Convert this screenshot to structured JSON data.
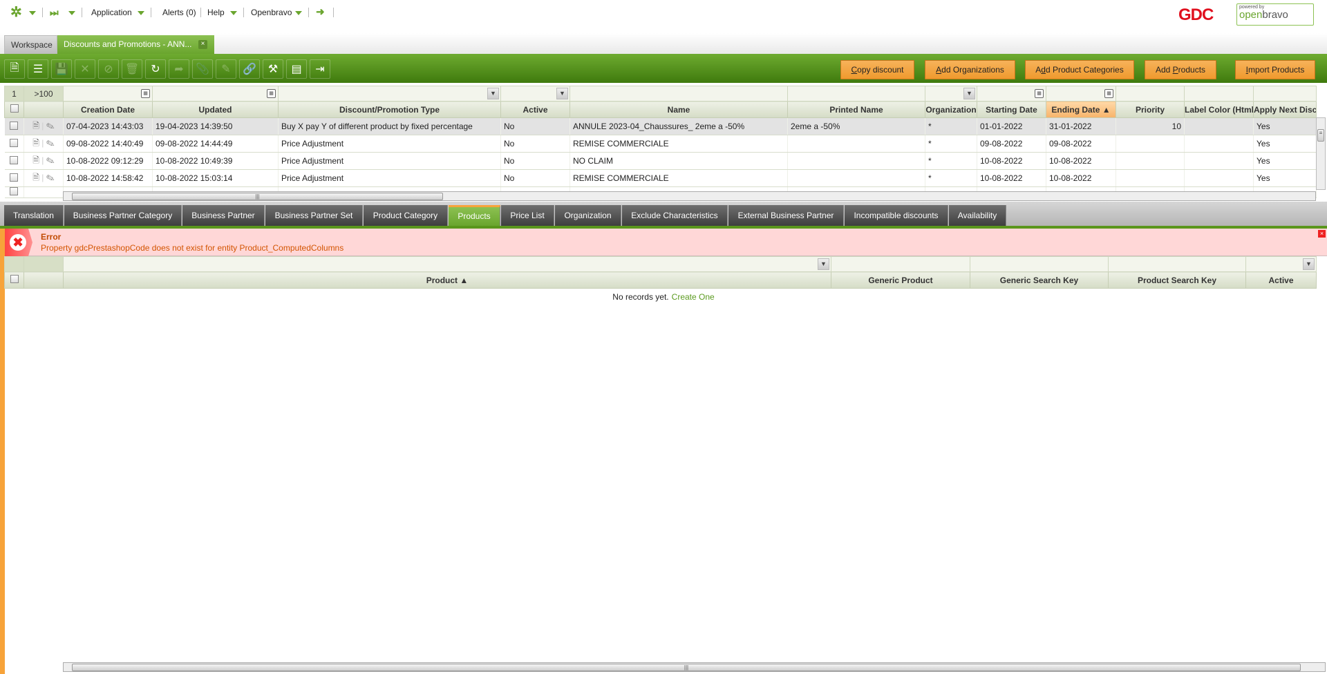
{
  "top_menu": {
    "application": "Application",
    "alerts": "Alerts (0)",
    "help": "Help",
    "openbravo": "Openbravo"
  },
  "logos": {
    "gdc": "GDC",
    "openbravo": "powered by openbravo"
  },
  "main_tabs": {
    "workspace": "Workspace",
    "active": "Discounts and Promotions - ANN...",
    "close": "×"
  },
  "toolbar": {
    "icons": [
      "new-document",
      "new-row",
      "save",
      "save-close",
      "undo",
      "delete",
      "refresh",
      "export",
      "attach",
      "audit",
      "link",
      "customize",
      "grid-form-toggle",
      "import"
    ],
    "buttons": [
      {
        "pre": "",
        "u": "C",
        "post": "opy discount"
      },
      {
        "pre": "",
        "u": "A",
        "post": "dd Organizations"
      },
      {
        "pre": "A",
        "u": "d",
        "post": "d Product Categories"
      },
      {
        "pre": "Add ",
        "u": "P",
        "post": "roducts"
      },
      {
        "pre": "",
        "u": "I",
        "post": "mport Products"
      }
    ]
  },
  "grid": {
    "page": "1",
    "count": ">100",
    "columns": [
      "Creation Date",
      "Updated",
      "Discount/Promotion Type",
      "Active",
      "Name",
      "Printed Name",
      "Organization",
      "Starting Date",
      "Ending Date ▲",
      "Priority",
      "Label Color (Html)",
      "Apply Next Disco"
    ],
    "rows": [
      [
        "07-04-2023 14:43:03",
        "19-04-2023 14:39:50",
        "Buy X pay Y of different product by fixed percentage",
        "No",
        "ANNULE 2023-04_Chaussures_ 2eme a -50%",
        "2eme a -50%",
        "*",
        "01-01-2022",
        "31-01-2022",
        "10",
        "",
        "Yes"
      ],
      [
        "09-08-2022 14:40:49",
        "09-08-2022 14:44:49",
        "Price Adjustment",
        "No",
        "REMISE COMMERCIALE",
        "",
        "*",
        "09-08-2022",
        "09-08-2022",
        "",
        "",
        "Yes"
      ],
      [
        "10-08-2022 09:12:29",
        "10-08-2022 10:49:39",
        "Price Adjustment",
        "No",
        "NO CLAIM",
        "",
        "*",
        "10-08-2022",
        "10-08-2022",
        "",
        "",
        "Yes"
      ],
      [
        "10-08-2022 14:58:42",
        "10-08-2022 15:03:14",
        "Price Adjustment",
        "No",
        "REMISE COMMERCIALE",
        "",
        "*",
        "10-08-2022",
        "10-08-2022",
        "",
        "",
        "Yes"
      ]
    ]
  },
  "subtabs": [
    "Translation",
    "Business Partner Category",
    "Business Partner",
    "Business Partner Set",
    "Product Category",
    "Products",
    "Price List",
    "Organization",
    "Exclude Characteristics",
    "External Business Partner",
    "Incompatible discounts",
    "Availability"
  ],
  "active_subtab": "Products",
  "error": {
    "title": "Error",
    "message": "Property gdcPrestashopCode does not exist for entity Product_ComputedColumns"
  },
  "subgrid": {
    "columns": [
      "Product ▲",
      "Generic Product",
      "Generic Search Key",
      "Product Search Key",
      "Active"
    ],
    "empty": "No records yet.",
    "create": "Create One"
  },
  "colors": {
    "accent": "#6aa52e",
    "orange": "#f7a33a",
    "error_bg": "#ffd7d7"
  }
}
